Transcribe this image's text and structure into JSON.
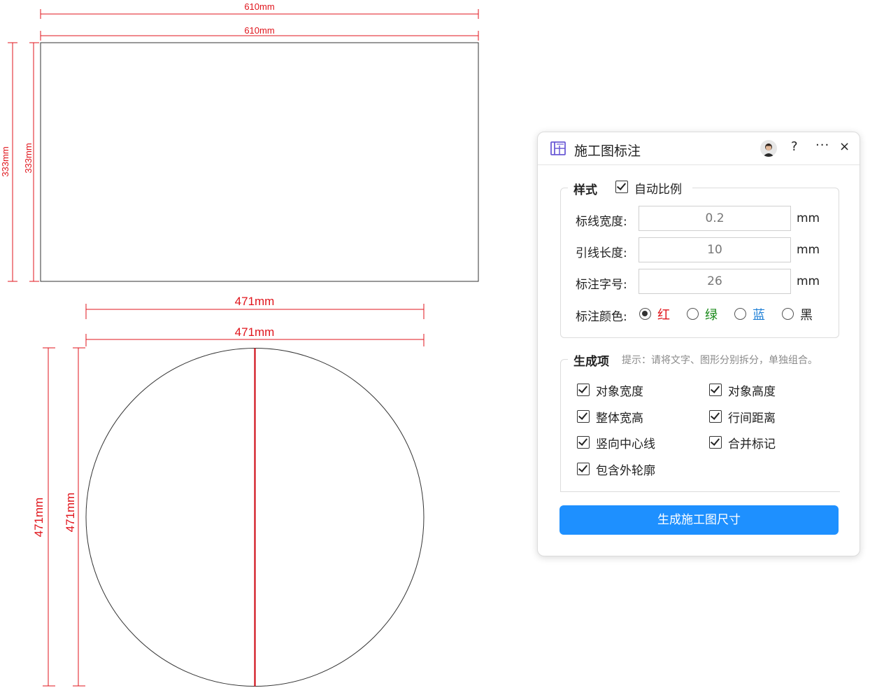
{
  "drawing": {
    "rect_width_label": "610mm",
    "rect_height_label": "333mm",
    "circle_diameter_label": "471mm"
  },
  "panel": {
    "title": "施工图标注",
    "help": "?",
    "more": "···",
    "close": "×",
    "style_group": {
      "title": "样式",
      "auto_scale_label": "自动比例",
      "line_width_label": "标线宽度:",
      "line_width_value": "0.2",
      "leader_length_label": "引线长度:",
      "leader_length_value": "10",
      "font_size_label": "标注字号:",
      "font_size_value": "26",
      "unit": "mm",
      "color_label": "标注颜色:",
      "colors": [
        {
          "label": "红",
          "color": "#e0151c",
          "selected": true
        },
        {
          "label": "绿",
          "color": "#1a8a1a",
          "selected": false
        },
        {
          "label": "蓝",
          "color": "#1e7fd6",
          "selected": false
        },
        {
          "label": "黑",
          "color": "#222222",
          "selected": false
        }
      ]
    },
    "generate_group": {
      "title": "生成项",
      "hint": "提示：请将文字、图形分别拆分，单独组合。",
      "items": [
        {
          "label": "对象宽度",
          "checked": true
        },
        {
          "label": "对象高度",
          "checked": true
        },
        {
          "label": "整体宽高",
          "checked": true
        },
        {
          "label": "行间距离",
          "checked": true
        },
        {
          "label": "竖向中心线",
          "checked": true
        },
        {
          "label": "合并标记",
          "checked": true
        },
        {
          "label": "包含外轮廓",
          "checked": true
        }
      ]
    },
    "generate_button": "生成施工图尺寸"
  },
  "colors": {
    "dimension": "#e0151c",
    "button": "#1e90ff"
  }
}
